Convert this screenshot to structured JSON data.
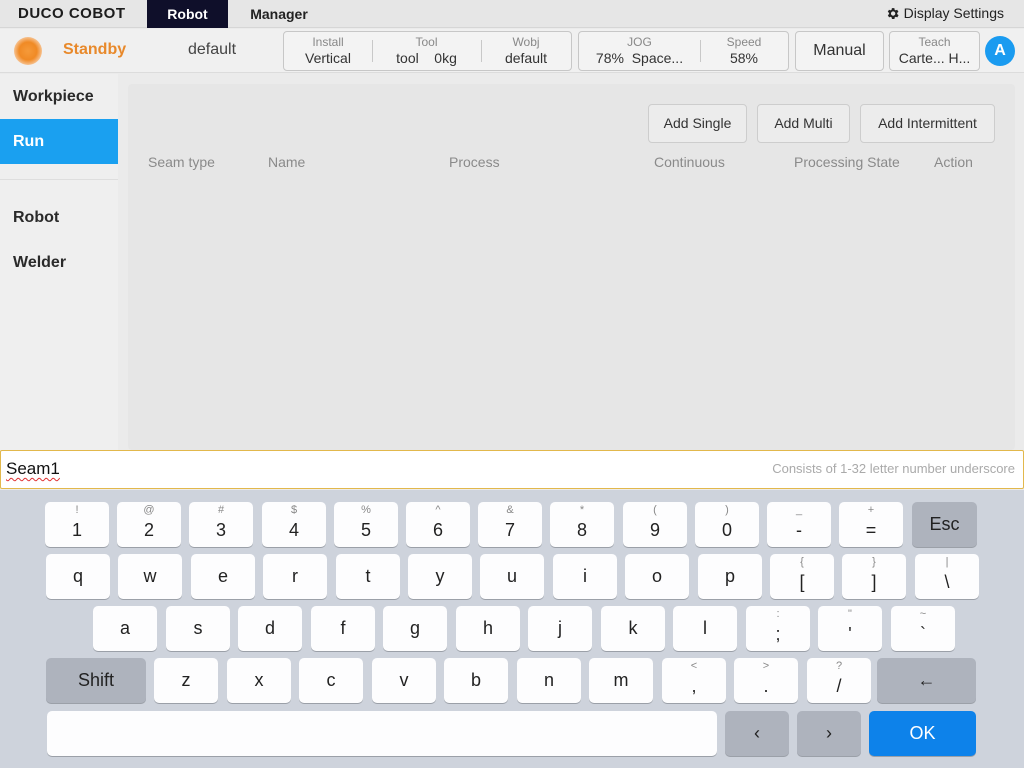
{
  "topbar": {
    "logo": "DUCO COBOT",
    "tabs": [
      "Robot",
      "Manager"
    ],
    "display_settings": "Display Settings"
  },
  "status": {
    "state": "Standby",
    "project": "default",
    "install": {
      "label": "Install",
      "value": "Vertical"
    },
    "tool": {
      "label": "Tool",
      "value": "tool",
      "weight": "0kg"
    },
    "wobj": {
      "label": "Wobj",
      "value": "default"
    },
    "jog": {
      "label": "JOG",
      "value": "78%",
      "space": "Space..."
    },
    "speed": {
      "label": "Speed",
      "value": "58%"
    },
    "mode": "Manual",
    "teach": {
      "label": "Teach",
      "value": "Carte... H..."
    },
    "avatar": "A"
  },
  "sidebar": {
    "items": [
      "Workpiece",
      "Run",
      "Robot",
      "Welder"
    ],
    "active": "Run"
  },
  "main": {
    "buttons": [
      "Add Single",
      "Add Multi",
      "Add Intermittent"
    ],
    "columns": [
      "Seam type",
      "Name",
      "Process",
      "Continuous",
      "Processing State",
      "Action"
    ]
  },
  "input": {
    "value": "Seam1",
    "hint": "Consists of 1-32 letter number underscore"
  },
  "keyboard": {
    "row1": [
      {
        "top": "!",
        "key": "1"
      },
      {
        "top": "@",
        "key": "2"
      },
      {
        "top": "#",
        "key": "3"
      },
      {
        "top": "$",
        "key": "4"
      },
      {
        "top": "%",
        "key": "5"
      },
      {
        "top": "^",
        "key": "6"
      },
      {
        "top": "&",
        "key": "7"
      },
      {
        "top": "*",
        "key": "8"
      },
      {
        "top": "(",
        "key": "9"
      },
      {
        "top": ")",
        "key": "0"
      },
      {
        "top": "_",
        "key": "-"
      },
      {
        "top": "+",
        "key": "="
      }
    ],
    "esc": "Esc",
    "row2": [
      {
        "top": "",
        "key": "q"
      },
      {
        "top": "",
        "key": "w"
      },
      {
        "top": "",
        "key": "e"
      },
      {
        "top": "",
        "key": "r"
      },
      {
        "top": "",
        "key": "t"
      },
      {
        "top": "",
        "key": "y"
      },
      {
        "top": "",
        "key": "u"
      },
      {
        "top": "",
        "key": "i"
      },
      {
        "top": "",
        "key": "o"
      },
      {
        "top": "",
        "key": "p"
      },
      {
        "top": "{",
        "key": "["
      },
      {
        "top": "}",
        "key": "]"
      },
      {
        "top": "|",
        "key": "\\"
      }
    ],
    "row3": [
      {
        "top": "",
        "key": "a"
      },
      {
        "top": "",
        "key": "s"
      },
      {
        "top": "",
        "key": "d"
      },
      {
        "top": "",
        "key": "f"
      },
      {
        "top": "",
        "key": "g"
      },
      {
        "top": "",
        "key": "h"
      },
      {
        "top": "",
        "key": "j"
      },
      {
        "top": "",
        "key": "k"
      },
      {
        "top": "",
        "key": "l"
      },
      {
        "top": ":",
        "key": ";"
      },
      {
        "top": "\"",
        "key": "'"
      },
      {
        "top": "~",
        "key": "`"
      }
    ],
    "shift": "Shift",
    "row4": [
      {
        "top": "",
        "key": "z"
      },
      {
        "top": "",
        "key": "x"
      },
      {
        "top": "",
        "key": "c"
      },
      {
        "top": "",
        "key": "v"
      },
      {
        "top": "",
        "key": "b"
      },
      {
        "top": "",
        "key": "n"
      },
      {
        "top": "",
        "key": "m"
      },
      {
        "top": "<",
        "key": ","
      },
      {
        "top": ">",
        "key": "."
      },
      {
        "top": "?",
        "key": "/"
      }
    ],
    "backspace": "←",
    "left": "‹",
    "right": "›",
    "ok": "OK"
  },
  "colors": {
    "accent": "#1aa0f0",
    "standby": "#e8892b",
    "ok": "#0d82ea",
    "robot_tab": "#0f0f2a"
  }
}
